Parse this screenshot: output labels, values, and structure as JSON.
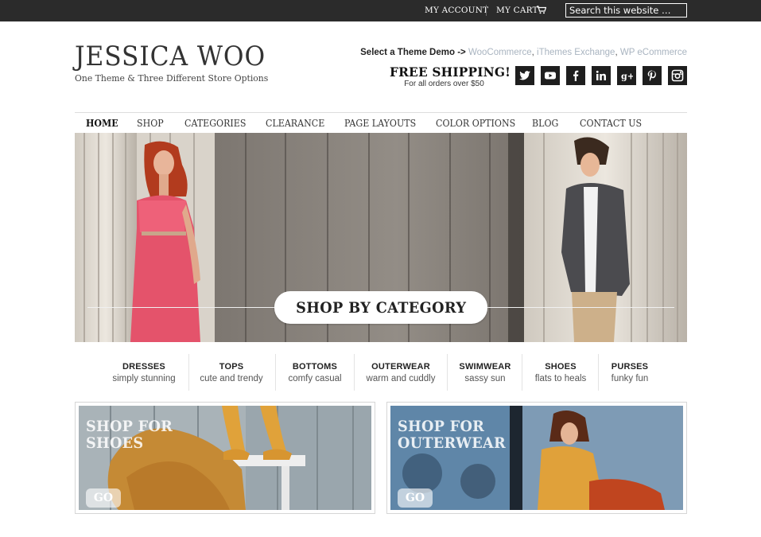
{
  "colors": {
    "topbar_bg": "#2b2b2b",
    "link_accent": "#a9b4c0",
    "social_bg": "#1e1e1e"
  },
  "topbar": {
    "my_account": "MY ACCOUNT",
    "my_cart": "MY CART",
    "cart_icon": "shopping-cart-icon",
    "search_placeholder": "Search this website …"
  },
  "header": {
    "logo": "JESSICA WOO",
    "tagline": "One Theme & Three Different Store Options",
    "theme_demo_label": "Select a Theme Demo ->",
    "theme_demo_links": [
      "WooCommerce",
      "iThemes Exchange",
      "WP eCommerce"
    ],
    "shipping_title": "FREE SHIPPING!",
    "shipping_sub": "For all orders over $50",
    "social_icons": [
      "twitter-icon",
      "youtube-icon",
      "facebook-icon",
      "linkedin-icon",
      "google-plus-icon",
      "pinterest-icon",
      "instagram-icon"
    ]
  },
  "nav": {
    "items": [
      "HOME",
      "SHOP",
      "CATEGORIES",
      "CLEARANCE",
      "PAGE LAYOUTS",
      "COLOR OPTIONS",
      "BLOG",
      "CONTACT US"
    ],
    "active": "HOME"
  },
  "hero": {
    "button": "SHOP BY CATEGORY"
  },
  "categories": [
    {
      "title": "DRESSES",
      "sub": "simply stunning"
    },
    {
      "title": "TOPS",
      "sub": "cute and trendy"
    },
    {
      "title": "BOTTOMS",
      "sub": "comfy casual"
    },
    {
      "title": "OUTERWEAR",
      "sub": "warm and cuddly"
    },
    {
      "title": "SWIMWEAR",
      "sub": "sassy sun"
    },
    {
      "title": "SHOES",
      "sub": "flats to heals"
    },
    {
      "title": "PURSES",
      "sub": "funky fun"
    }
  ],
  "promos": [
    {
      "title_line1": "SHOP FOR",
      "title_line2": "SHOES",
      "go": "GO"
    },
    {
      "title_line1": "SHOP FOR",
      "title_line2": "OUTERWEAR",
      "go": "GO"
    }
  ]
}
